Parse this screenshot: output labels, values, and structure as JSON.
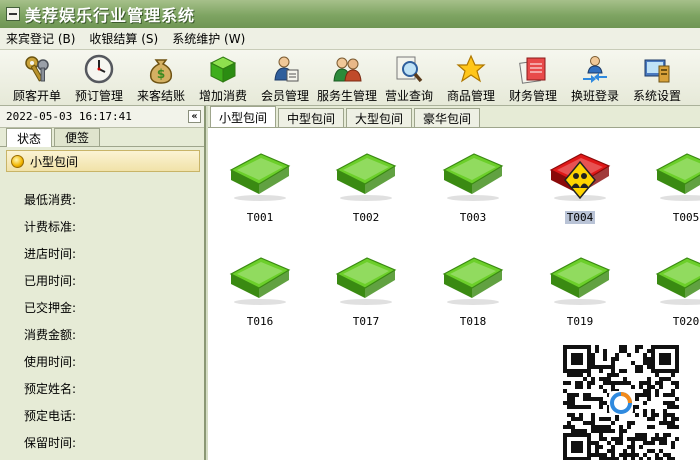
{
  "window": {
    "title": "美荐娱乐行业管理系统"
  },
  "menu": [
    {
      "label": "来宾登记 (B)"
    },
    {
      "label": "收银结算 (S)"
    },
    {
      "label": "系统维护 (W)"
    }
  ],
  "toolbar": [
    {
      "label": "顾客开单",
      "icon": "keys-icon"
    },
    {
      "label": "预订管理",
      "icon": "clock-icon"
    },
    {
      "label": "来客结账",
      "icon": "money-bag-icon"
    },
    {
      "label": "增加消费",
      "icon": "green-cube-icon"
    },
    {
      "label": "会员管理",
      "icon": "member-card-icon"
    },
    {
      "label": "服务生管理",
      "icon": "staff-icon"
    },
    {
      "label": "营业查询",
      "icon": "magnifier-icon"
    },
    {
      "label": "商品管理",
      "icon": "star-icon"
    },
    {
      "label": "财务管理",
      "icon": "finance-icon"
    },
    {
      "label": "换班登录",
      "icon": "shift-login-icon"
    },
    {
      "label": "系统设置",
      "icon": "system-settings-icon"
    }
  ],
  "left_panel": {
    "datetime": "2022-05-03 16:17:41",
    "collapse_glyph": "«",
    "tabs": [
      {
        "label": "状态"
      },
      {
        "label": "便签"
      }
    ],
    "section_title": "小型包间",
    "fields": [
      {
        "label": "最低消费:"
      },
      {
        "label": "计费标准:"
      },
      {
        "label": "进店时间:"
      },
      {
        "label": "已用时间:"
      },
      {
        "label": "已交押金:"
      },
      {
        "label": "消费金额:"
      },
      {
        "label": "使用时间:"
      },
      {
        "label": "预定姓名:"
      },
      {
        "label": "预定电话:"
      },
      {
        "label": "保留时间:"
      }
    ]
  },
  "room_tabs": [
    {
      "label": "小型包间"
    },
    {
      "label": "中型包间"
    },
    {
      "label": "大型包间"
    },
    {
      "label": "豪华包间"
    }
  ],
  "rooms": [
    {
      "label": "T001",
      "status": "free"
    },
    {
      "label": "T002",
      "status": "free"
    },
    {
      "label": "T003",
      "status": "free"
    },
    {
      "label": "T004",
      "status": "occupied"
    },
    {
      "label": "T005",
      "status": "free"
    },
    {
      "label": "T016",
      "status": "free"
    },
    {
      "label": "T017",
      "status": "free"
    },
    {
      "label": "T018",
      "status": "free"
    },
    {
      "label": "T019",
      "status": "free"
    },
    {
      "label": "T020",
      "status": "free"
    }
  ],
  "colors": {
    "free": "#6ccf2a",
    "occupied": "#e01818",
    "title_bar": "#7ea462"
  }
}
